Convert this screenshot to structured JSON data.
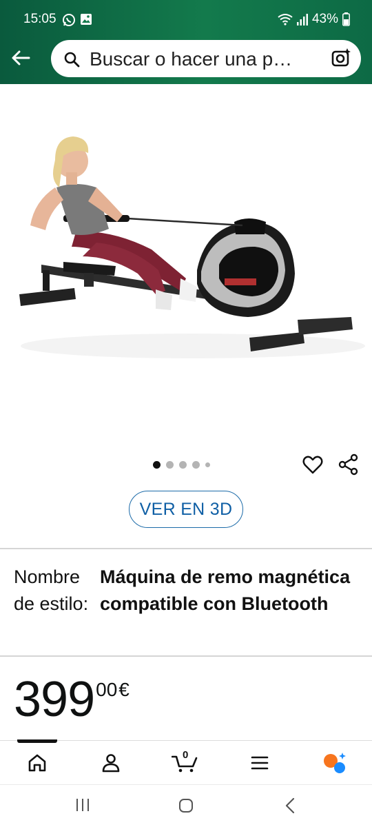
{
  "status_bar": {
    "time": "15:05",
    "battery": "43%",
    "icons": [
      "whatsapp-icon",
      "gallery-icon",
      "wifi-icon",
      "signal-icon",
      "battery-icon"
    ]
  },
  "header": {
    "search_placeholder": "Buscar o hacer una p…",
    "back_icon": "back-arrow-icon",
    "camera_icon": "camera-search-icon"
  },
  "gallery": {
    "image_count": 5,
    "active_index": 0
  },
  "actions": {
    "view_3d_label": "VER EN 3D"
  },
  "style": {
    "label": "Nombre de estilo:",
    "value": "Máquina de remo magnética compatible con Bluetooth"
  },
  "price": {
    "whole": "399",
    "fraction": "00",
    "currency": "€"
  },
  "tabbar": {
    "cart_count": "0",
    "items": [
      "home-icon",
      "account-icon",
      "cart-icon",
      "menu-icon",
      "rufus-icon"
    ]
  },
  "colors": {
    "header_green": "#0d6a45",
    "link_blue": "#0f5fa5",
    "rufus_orange": "#f7751e",
    "rufus_blue": "#1a8cff"
  }
}
